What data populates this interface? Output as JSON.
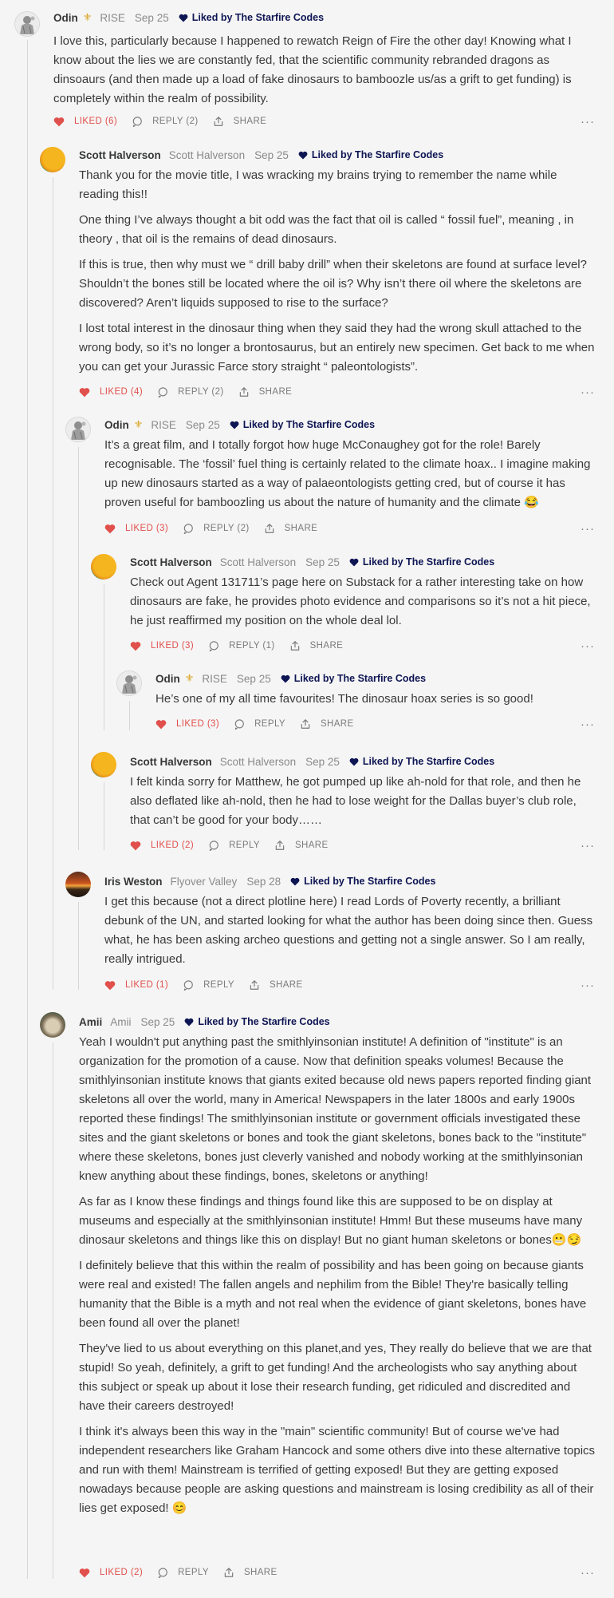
{
  "liked_by_text": "Liked by The Starfire Codes",
  "labels": {
    "reply": "REPLY",
    "share": "SHARE",
    "more": "···"
  },
  "comments": [
    {
      "author": "Odin",
      "badge": "⚜",
      "handle": "RISE",
      "date": "Sep 25",
      "avatar": "statue",
      "paragraphs": [
        "I love this, particularly because I happened to rewatch Reign of Fire the other day! Knowing what I know about the lies we are constantly fed, that the scientific community rebranded dragons as dinsoaurs (and then made up a load of fake dinosaurs to bamboozle us/as a grift to get funding) is completely within the realm of possibility."
      ],
      "liked_label": "LIKED (6)",
      "reply_label": "REPLY (2)"
    },
    {
      "author": "Scott Halverson",
      "badge": "",
      "handle": "Scott Halverson",
      "date": "Sep 25",
      "avatar": "orange",
      "paragraphs": [
        "Thank you for the movie title, I was wracking my brains trying to remember the name while reading this!!",
        "One thing I’ve always thought a bit odd was the fact that oil is called “ fossil fuel”, meaning , in theory , that oil is the remains of dead dinosaurs.",
        "If this is true, then why must we “ drill baby drill” when their skeletons are found at surface level? Shouldn’t the bones still be located where the oil is? Why isn’t there oil where the skeletons are discovered? Aren’t liquids supposed to rise to the surface?",
        "I lost total interest in the dinosaur thing when they said they had the wrong skull attached to the wrong body, so it’s no longer a brontosaurus, but an entirely new specimen. Get back to me when you can get your Jurassic Farce story straight “ paleontologists”."
      ],
      "liked_label": "LIKED (4)",
      "reply_label": "REPLY (2)"
    },
    {
      "author": "Odin",
      "badge": "⚜",
      "handle": "RISE",
      "date": "Sep 25",
      "avatar": "statue",
      "paragraphs": [
        "It’s a great film, and I totally forgot how huge McConaughey got for the role! Barely recognisable. The ‘fossil’ fuel thing is certainly related to the climate hoax.. I imagine making up new dinosaurs started as a way of palaeontologists getting cred, but of course it has proven useful for bamboozling us about the nature of humanity and the climate 😂"
      ],
      "liked_label": "LIKED (3)",
      "reply_label": "REPLY (2)"
    },
    {
      "author": "Scott Halverson",
      "badge": "",
      "handle": "Scott Halverson",
      "date": "Sep 25",
      "avatar": "orange",
      "paragraphs": [
        "Check out Agent 131711’s page here on Substack for a rather interesting take on how dinosaurs are fake, he provides photo evidence and comparisons so it’s not a hit piece, he just reaffirmed my position on the whole deal lol."
      ],
      "liked_label": "LIKED (3)",
      "reply_label": "REPLY (1)"
    },
    {
      "author": "Odin",
      "badge": "⚜",
      "handle": "RISE",
      "date": "Sep 25",
      "avatar": "statue",
      "paragraphs": [
        "He’s one of my all time favourites! The dinosaur hoax series is so good!"
      ],
      "liked_label": "LIKED (3)",
      "reply_label": "REPLY"
    },
    {
      "author": "Scott Halverson",
      "badge": "",
      "handle": "Scott Halverson",
      "date": "Sep 25",
      "avatar": "orange",
      "paragraphs": [
        "I felt kinda sorry for Matthew, he got pumped up like ah-nold for that role, and then he also deflated like ah-nold, then he had to lose weight for the Dallas buyer’s club role, that can’t be good for your body……"
      ],
      "liked_label": "LIKED (2)",
      "reply_label": "REPLY"
    },
    {
      "author": "Iris Weston",
      "badge": "",
      "handle": "Flyover Valley",
      "date": "Sep 28",
      "avatar": "sunset",
      "paragraphs": [
        "I get this because (not a direct plotline here) I read Lords of Poverty recently, a brilliant debunk of the UN, and started looking for what the author has been doing since then. Guess what, he has been asking archeo questions and getting not a single answer. So I am really, really intrigued."
      ],
      "liked_label": "LIKED (1)",
      "reply_label": "REPLY"
    },
    {
      "author": "Amii",
      "badge": "",
      "handle": "Amii",
      "date": "Sep 25",
      "avatar": "cat",
      "paragraphs": [
        "Yeah I wouldn't put anything past the smithlyinsonian institute! A definition of \"institute\" is an organization for the promotion of a cause. Now that definition speaks volumes! Because the smithlyinsonian institute knows that giants exited because old news papers reported finding giant skeletons all over the world, many in America! Newspapers in the later 1800s and early 1900s reported these findings! The smithlyinsonian institute or government officials investigated these sites and the giant skeletons or bones and took the giant skeletons, bones back to the \"institute\" where these skeletons, bones just cleverly vanished and nobody working at the smithlyinsonian knew anything about these findings, bones, skeletons or anything!",
        "As far as I know these findings and things found like this are supposed to be on display at museums and especially at the smithlyinsonian institute! Hmm! But these museums have many dinosaur skeletons and things like this on display! But no giant human skeletons or bones😬😏",
        "I definitely believe that this within the realm of possibility and has been going on because giants were real and existed! The fallen angels and nephilim from the Bible! They're basically telling humanity that the Bible is a myth and not real when the evidence of giant skeletons, bones have been found all over the planet!",
        "They've lied to us about everything on this planet,and yes, They really do believe that we are that stupid! So yeah, definitely, a grift to get funding! And the archeologists who say anything about this subject or speak up about it lose their research funding, get ridiculed and discredited and have their careers destroyed!",
        "I think it's always been this way in the \"main\" scientific community! But of course we've had independent researchers like Graham Hancock and some others dive into these alternative topics and run with them! Mainstream is terrified of getting exposed! But they are getting exposed nowadays because people are asking questions and mainstream is losing credibility as all of their lies get exposed! 😊"
      ],
      "liked_label": "LIKED (2)",
      "reply_label": "REPLY"
    }
  ]
}
